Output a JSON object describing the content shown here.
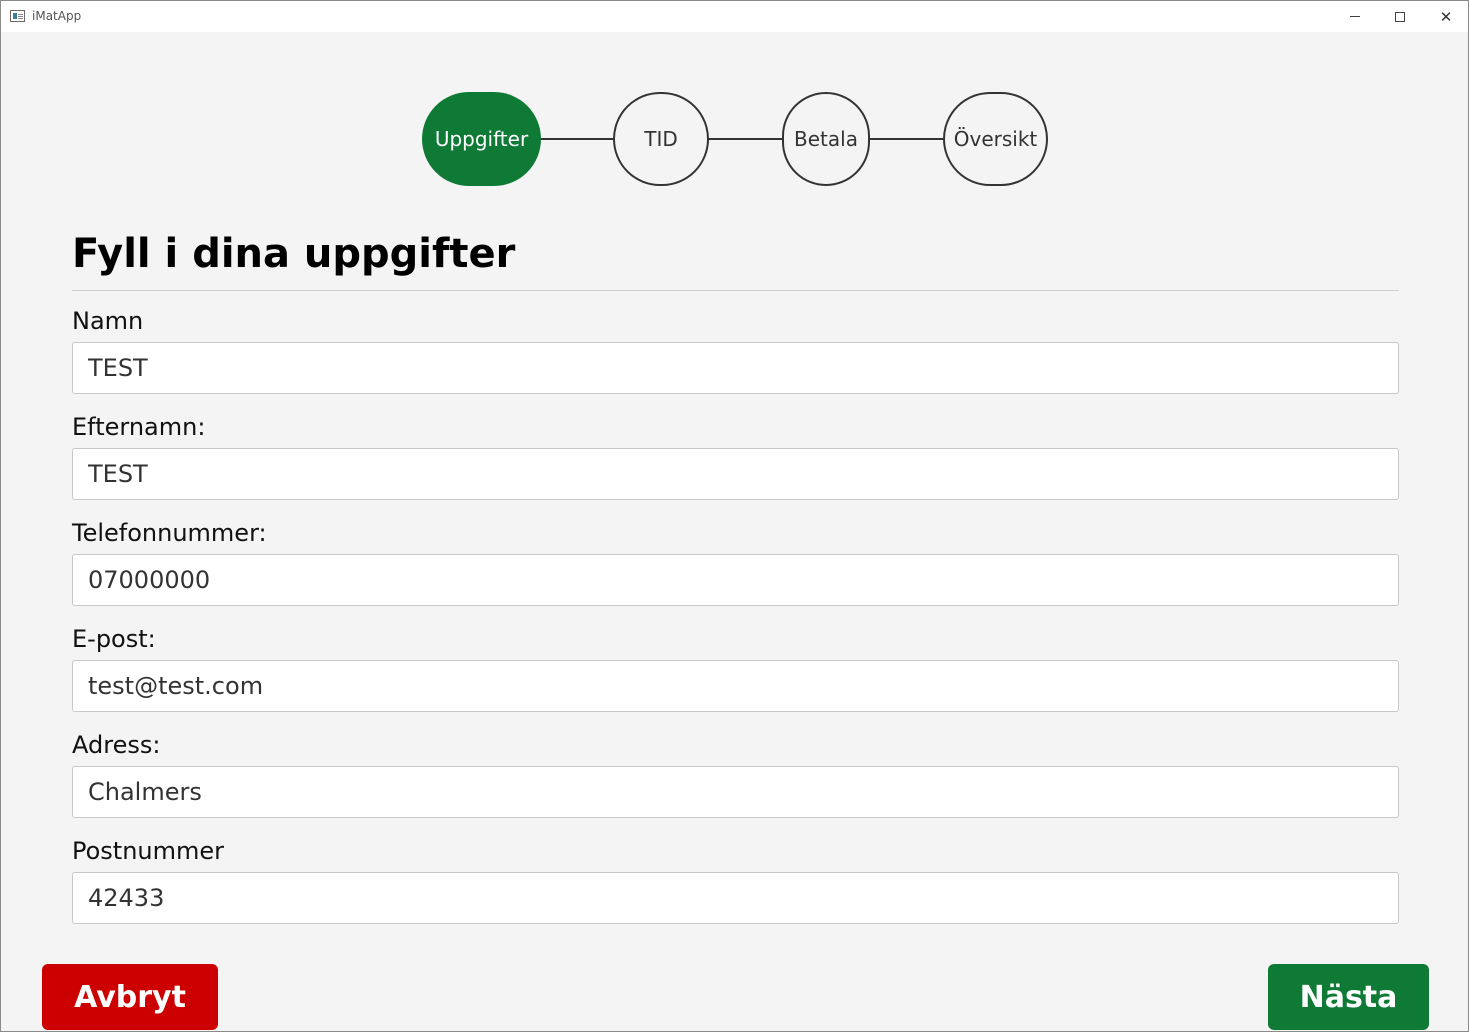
{
  "window": {
    "title": "iMatApp"
  },
  "stepper": {
    "steps": [
      {
        "label": "Uppgifter",
        "active": true
      },
      {
        "label": "TID",
        "active": false
      },
      {
        "label": "Betala",
        "active": false
      },
      {
        "label": "Översikt",
        "active": false
      }
    ]
  },
  "form": {
    "heading": "Fyll i dina uppgifter",
    "fields": [
      {
        "label": "Namn",
        "value": "TEST"
      },
      {
        "label": "Efternamn:",
        "value": "TEST"
      },
      {
        "label": "Telefonnummer:",
        "value": "07000000"
      },
      {
        "label": "E-post:",
        "value": "test@test.com"
      },
      {
        "label": "Adress:",
        "value": "Chalmers"
      },
      {
        "label": "Postnummer",
        "value": "42433"
      }
    ]
  },
  "actions": {
    "cancel_label": "Avbryt",
    "next_label": "Nästa"
  },
  "colors": {
    "accent_green": "#0f7a36",
    "cancel_red": "#cc0000"
  }
}
